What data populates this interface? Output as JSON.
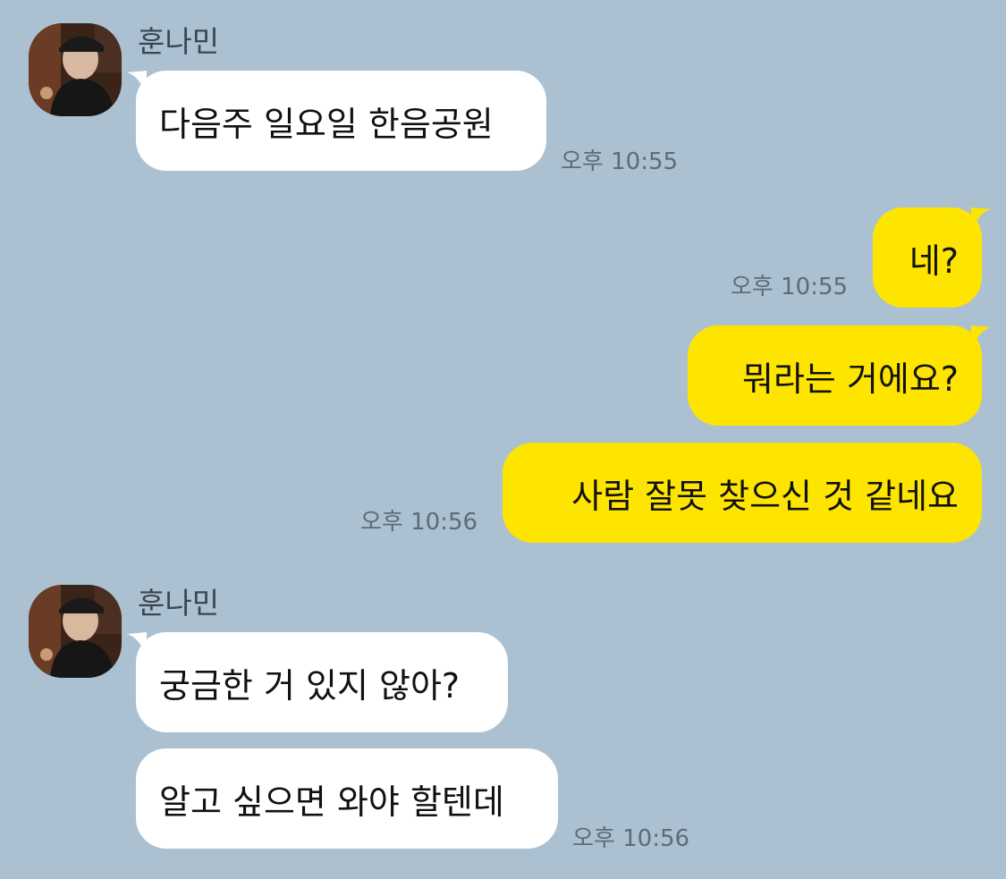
{
  "colors": {
    "background": "#abc1d1",
    "incoming_bubble": "#ffffff",
    "outgoing_bubble": "#fee500",
    "timestamp": "#5e6b76",
    "sender_name": "#3c4650"
  },
  "messages": [
    {
      "direction": "incoming",
      "sender": "훈나민",
      "text": "다음주 일요일 한음공원",
      "time": "오후 10:55"
    },
    {
      "direction": "outgoing",
      "text": "네?",
      "time": "오후 10:55"
    },
    {
      "direction": "outgoing",
      "text": "뭐라는 거에요?",
      "time": ""
    },
    {
      "direction": "outgoing",
      "text": "사람 잘못 찾으신 것 같네요",
      "time": "오후 10:56"
    },
    {
      "direction": "incoming",
      "sender": "훈나민",
      "text": "궁금한 거 있지 않아?",
      "time": ""
    },
    {
      "direction": "incoming",
      "text": "알고 싶으면 와야 할텐데",
      "time": "오후 10:56"
    }
  ]
}
